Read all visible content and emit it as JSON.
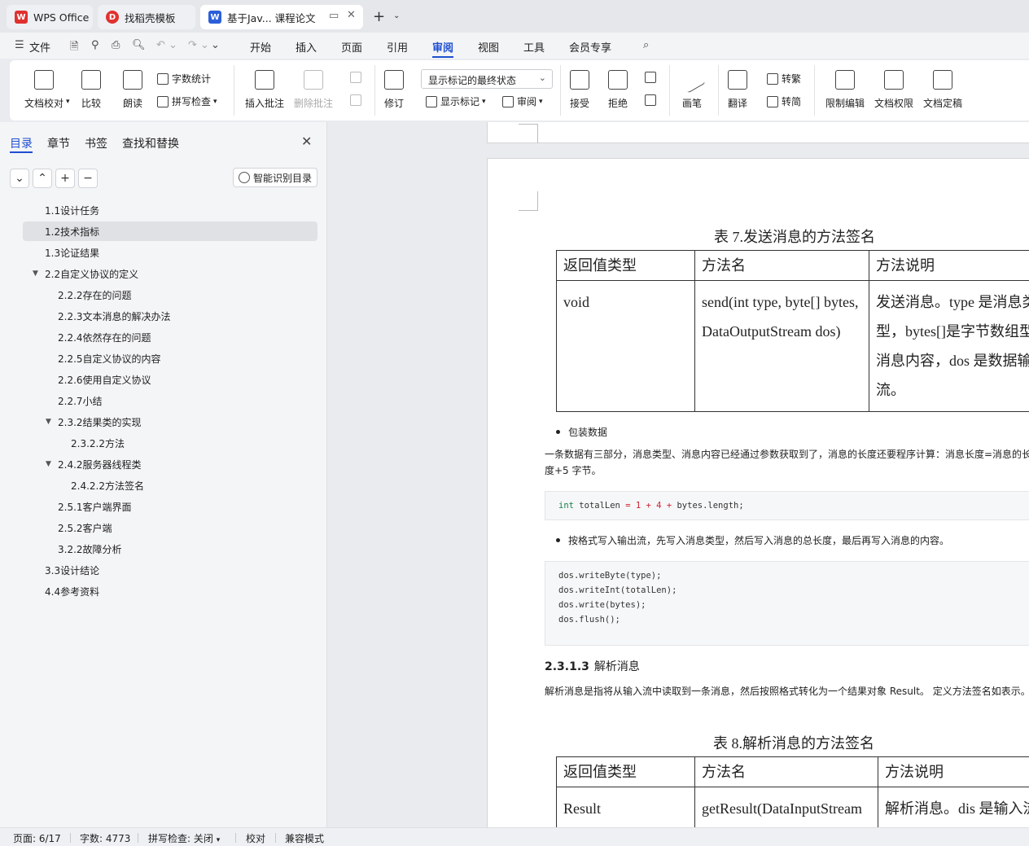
{
  "titlebar": {
    "tabs": [
      {
        "label": "WPS Office",
        "icon": "wps-logo-icon"
      },
      {
        "label": "找稻壳模板",
        "icon": "docer-icon"
      },
      {
        "label": "基于Jav... 课程论文",
        "icon": "word-doc-icon"
      }
    ],
    "new_tab_symbol": "+",
    "new_tab_arrow": "⌄"
  },
  "menubar": {
    "file_label": "文件",
    "items": [
      "开始",
      "插入",
      "页面",
      "引用",
      "审阅",
      "视图",
      "工具",
      "会员专享"
    ],
    "active": "审阅"
  },
  "ribbon": {
    "doc_proof": "文档校对",
    "compare": "比较",
    "read_aloud": "朗读",
    "word_count": "字数统计",
    "spell_check": "拼写检查",
    "insert_comment": "插入批注",
    "delete_comment": "删除批注",
    "revise": "修订",
    "markup_state": "显示标记的最终状态",
    "show_markup": "显示标记",
    "review": "审阅",
    "accept": "接受",
    "reject": "拒绝",
    "pen": "画笔",
    "translate": "翻译",
    "to_traditional": "转繁",
    "to_simplified": "转简",
    "restrict_edit": "限制编辑",
    "doc_rights": "文档权限",
    "doc_finalize": "文档定稿"
  },
  "leftpanel": {
    "tabs": [
      "目录",
      "章节",
      "书签",
      "查找和替换"
    ],
    "active_tab": "目录",
    "smart_toc_label": "智能识别目录",
    "toc": [
      {
        "label": "1.1设计任务",
        "level": 0,
        "toggle": ""
      },
      {
        "label": "1.2技术指标",
        "level": 0,
        "toggle": "",
        "selected": true
      },
      {
        "label": "1.3论证结果",
        "level": 0,
        "toggle": ""
      },
      {
        "label": "2.2自定义协议的定义",
        "level": 0,
        "toggle": "▼"
      },
      {
        "label": "2.2.2存在的问题",
        "level": 1,
        "toggle": ""
      },
      {
        "label": "2.2.3文本消息的解决办法",
        "level": 1,
        "toggle": ""
      },
      {
        "label": "2.2.4依然存在的问题",
        "level": 1,
        "toggle": ""
      },
      {
        "label": "2.2.5自定义协议的内容",
        "level": 1,
        "toggle": ""
      },
      {
        "label": "2.2.6使用自定义协议",
        "level": 1,
        "toggle": ""
      },
      {
        "label": "2.2.7小结",
        "level": 1,
        "toggle": ""
      },
      {
        "label": "2.3.2结果类的实现",
        "level": 1,
        "toggle": "▼"
      },
      {
        "label": "2.3.2.2方法",
        "level": 2,
        "toggle": ""
      },
      {
        "label": "2.4.2服务器线程类",
        "level": 1,
        "toggle": "▼"
      },
      {
        "label": "2.4.2.2方法签名",
        "level": 2,
        "toggle": ""
      },
      {
        "label": "2.5.1客户端界面",
        "level": 1,
        "toggle": ""
      },
      {
        "label": "2.5.2客户端",
        "level": 1,
        "toggle": ""
      },
      {
        "label": "3.2.2故障分析",
        "level": 1,
        "toggle": ""
      },
      {
        "label": "3.3设计结论",
        "level": 0,
        "toggle": ""
      },
      {
        "label": "4.4参考资料",
        "level": 0,
        "toggle": ""
      }
    ]
  },
  "document": {
    "table7": {
      "caption": "表 7.发送消息的方法签名",
      "headers": [
        "返回值类型",
        "方法名",
        "方法说明"
      ],
      "row": [
        "void",
        "send(int type, byte[] bytes, DataOutputStream dos)",
        "发送消息。type 是消息类型，bytes[]是字节数组型的消息内容，dos 是数据输出流。"
      ]
    },
    "bullet1": "包装数据",
    "para1": "一条数据有三部分，消息类型、消息内容已经通过参数获取到了，消息的长度还要程序计算：消息长度=消息的长度+5 字节。",
    "code1": {
      "kw": "int",
      "var": "totalLen",
      "eq": "=",
      "n1": "1",
      "plus": "+",
      "n2": "4",
      "rest": "bytes.length;"
    },
    "bullet2": "按格式写入输出流，先写入消息类型，然后写入消息的总长度，最后再写入消息的内容。",
    "code2": [
      "dos.writeByte(type);",
      "dos.writeInt(totalLen);",
      "dos.write(bytes);",
      "dos.flush();"
    ],
    "heading_num": "2.3.1.3",
    "heading_text": "解析消息",
    "para2": "解析消息是指将从输入流中读取到一条消息，然后按照格式转化为一个结果对象 Result。 定义方法签名如表示。",
    "table8": {
      "caption": "表 8.解析消息的方法签名",
      "headers": [
        "返回值类型",
        "方法名",
        "方法说明"
      ],
      "row": [
        "Result",
        "getResult(DataInputStream",
        "解析消息。dis 是输入流"
      ]
    }
  },
  "statusbar": {
    "page": "页面: 6/17",
    "words": "字数: 4773",
    "spell": "拼写检查: 关闭",
    "proof": "校对",
    "compat": "兼容模式"
  },
  "colors": {
    "accent": "#1f4fd1",
    "wps_red": "#e0312f",
    "word_blue": "#2b5fd9"
  }
}
